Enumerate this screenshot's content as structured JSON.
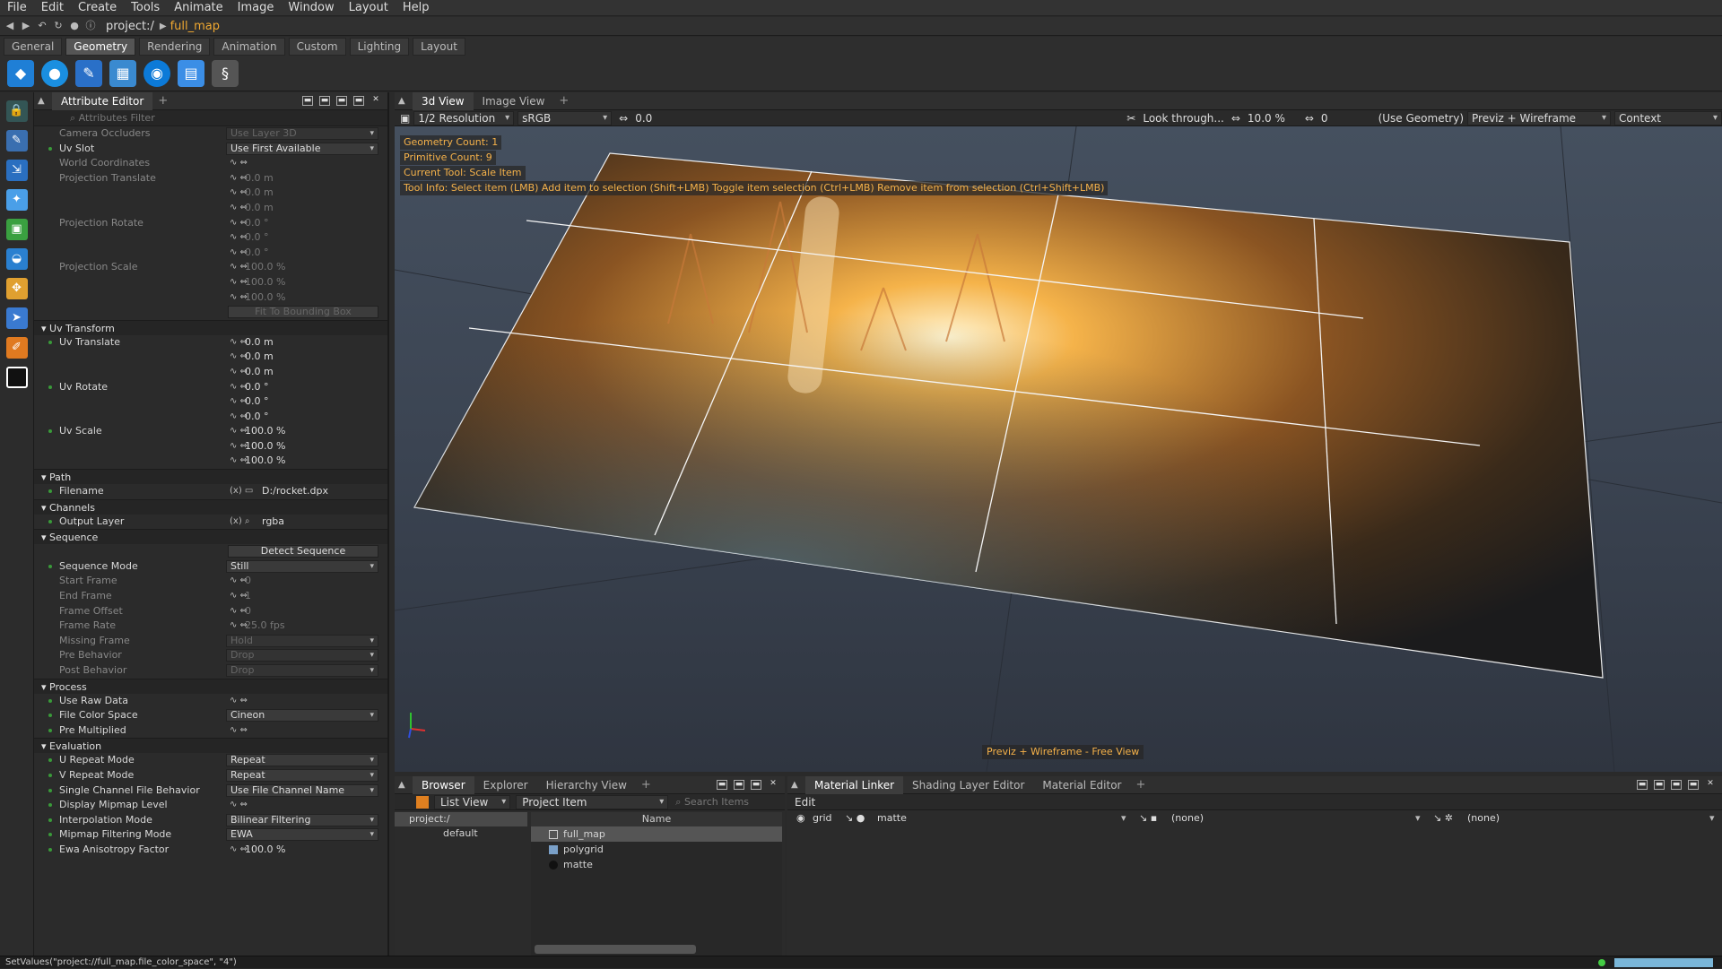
{
  "menu": [
    "File",
    "Edit",
    "Create",
    "Tools",
    "Animate",
    "Image",
    "Window",
    "Layout",
    "Help"
  ],
  "path": {
    "root": "project:/",
    "current": "full_map"
  },
  "shelf_tabs": [
    "General",
    "Geometry",
    "Rendering",
    "Animation",
    "Custom",
    "Lighting",
    "Layout"
  ],
  "attribute_editor": {
    "tab": "Attribute Editor",
    "filter_placeholder": "Attributes Filter",
    "rows_top": [
      {
        "label": "Camera Occluders",
        "value": "Use Layer 3D",
        "dim": true,
        "kind": "box"
      },
      {
        "label": "Uv Slot",
        "value": "Use First Available",
        "kind": "box"
      },
      {
        "label": "World Coordinates",
        "value": "",
        "dim": true,
        "kind": "check"
      },
      {
        "label": "Projection Translate",
        "value": "0.0 m",
        "dim": true
      },
      {
        "label": "",
        "value": "0.0 m",
        "dim": true
      },
      {
        "label": "",
        "value": "0.0 m",
        "dim": true
      },
      {
        "label": "Projection Rotate",
        "value": "0.0 °",
        "dim": true
      },
      {
        "label": "",
        "value": "0.0 °",
        "dim": true
      },
      {
        "label": "",
        "value": "0.0 °",
        "dim": true
      },
      {
        "label": "Projection Scale",
        "value": "100.0 %",
        "dim": true
      },
      {
        "label": "",
        "value": "100.0 %",
        "dim": true
      },
      {
        "label": "",
        "value": "100.0 %",
        "dim": true
      },
      {
        "label": "",
        "value": "Fit To Bounding Box",
        "dim": true,
        "kind": "btn"
      }
    ],
    "sections": {
      "uv_transform": "Uv Transform",
      "path": "Path",
      "channels": "Channels",
      "sequence": "Sequence",
      "process": "Process",
      "evaluation": "Evaluation"
    },
    "uv": [
      {
        "label": "Uv Translate",
        "value": "0.0 m"
      },
      {
        "label": "",
        "value": "0.0 m"
      },
      {
        "label": "",
        "value": "0.0 m"
      },
      {
        "label": "Uv Rotate",
        "value": "0.0 °"
      },
      {
        "label": "",
        "value": "0.0 °"
      },
      {
        "label": "",
        "value": "0.0 °"
      },
      {
        "label": "Uv Scale",
        "value": "100.0 %"
      },
      {
        "label": "",
        "value": "100.0 %"
      },
      {
        "label": "",
        "value": "100.0 %"
      }
    ],
    "filename": {
      "label": "Filename",
      "value": "D:/rocket.dpx"
    },
    "output_layer": {
      "label": "Output Layer",
      "value": "rgba"
    },
    "detect_sequence": "Detect Sequence",
    "sequence": [
      {
        "label": "Sequence Mode",
        "value": "Still",
        "kind": "box"
      },
      {
        "label": "Start Frame",
        "value": "0",
        "dim": true
      },
      {
        "label": "End Frame",
        "value": "1",
        "dim": true
      },
      {
        "label": "Frame Offset",
        "value": "0",
        "dim": true
      },
      {
        "label": "Frame Rate",
        "value": "25.0 fps",
        "dim": true
      },
      {
        "label": "Missing Frame",
        "value": "Hold",
        "dim": true,
        "kind": "box"
      },
      {
        "label": "Pre Behavior",
        "value": "Drop",
        "dim": true,
        "kind": "box"
      },
      {
        "label": "Post Behavior",
        "value": "Drop",
        "dim": true,
        "kind": "box"
      }
    ],
    "process": [
      {
        "label": "Use Raw Data",
        "value": ""
      },
      {
        "label": "File Color Space",
        "value": "Cineon",
        "kind": "box"
      },
      {
        "label": "Pre Multiplied",
        "value": ""
      }
    ],
    "evaluation": [
      {
        "label": "U Repeat Mode",
        "value": "Repeat",
        "kind": "box"
      },
      {
        "label": "V Repeat Mode",
        "value": "Repeat",
        "kind": "box"
      },
      {
        "label": "Single Channel File Behavior",
        "value": "Use File Channel Name",
        "kind": "box"
      },
      {
        "label": "Display Mipmap Level",
        "value": ""
      },
      {
        "label": "Interpolation Mode",
        "value": "Bilinear Filtering",
        "kind": "box"
      },
      {
        "label": "Mipmap Filtering Mode",
        "value": "EWA",
        "kind": "box"
      },
      {
        "label": "Ewa Anisotropy Factor",
        "value": "100.0 %"
      }
    ]
  },
  "view": {
    "tabs": [
      "3d View",
      "Image View"
    ],
    "resolution": "1/2 Resolution",
    "colorspace": "sRGB",
    "exposure": "0.0",
    "look_through": "Look through...",
    "zoom": "10.0 %",
    "zoom2": "0",
    "use_geometry": "(Use Geometry)",
    "mode": "Previz + Wireframe",
    "context": "Context",
    "info": [
      "Geometry Count: 1",
      "Primitive Count: 9",
      "Current Tool: Scale Item",
      "Tool Info: Select item (LMB)  Add item to selection (Shift+LMB)  Toggle item selection (Ctrl+LMB)  Remove item from selection (Ctrl+Shift+LMB)"
    ],
    "status": "Previz + Wireframe - Free View"
  },
  "browser": {
    "tabs": [
      "Browser",
      "Explorer",
      "Hierarchy View"
    ],
    "view_mode": "List View",
    "item_type": "Project Item",
    "search": "Search Items",
    "tree": [
      "project:/",
      "default"
    ],
    "name_header": "Name",
    "items": [
      "full_map",
      "polygrid",
      "matte"
    ]
  },
  "material_linker": {
    "tabs": [
      "Material Linker",
      "Shading Layer Editor",
      "Material Editor"
    ],
    "edit": "Edit",
    "geo": "grid",
    "material": "matte",
    "layer1": "(none)",
    "layer2": "(none)"
  },
  "statusbar": "SetValues(\"project://full_map.file_color_space\", \"4\")"
}
